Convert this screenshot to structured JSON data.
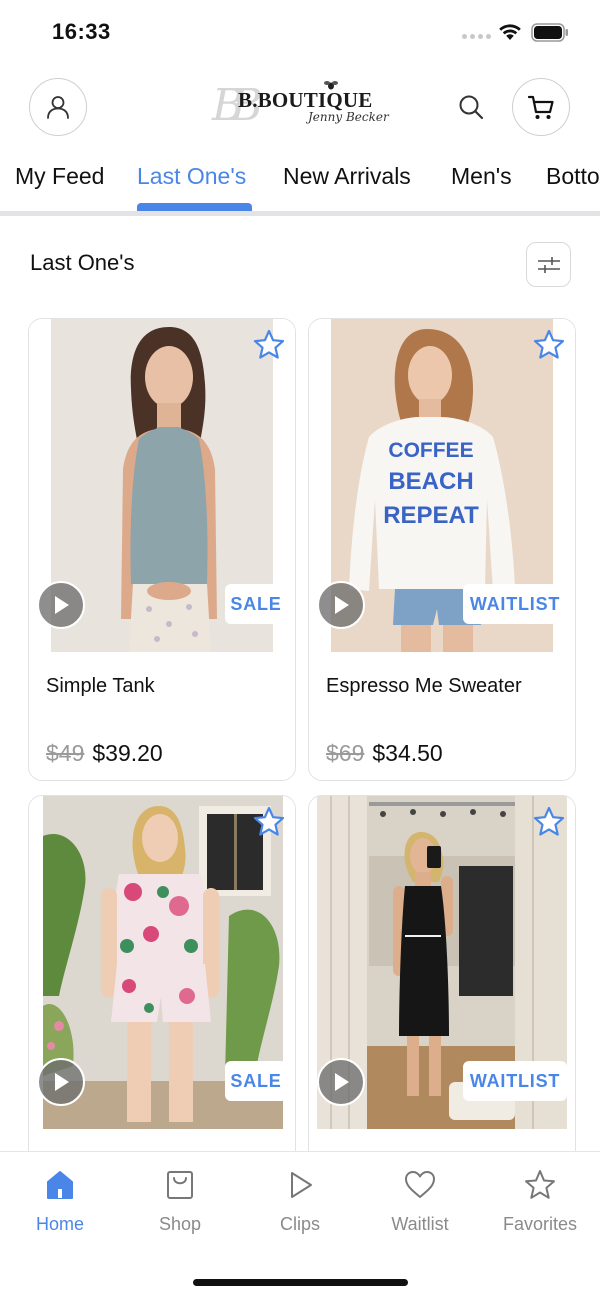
{
  "status_bar": {
    "time": "16:33"
  },
  "header": {
    "logo_text": "B.BOUTIQUE",
    "logo_signature": "Jenny Becker",
    "icons": {
      "profile": "person-icon",
      "search": "search-icon",
      "cart": "cart-icon"
    }
  },
  "tabs": [
    {
      "label": "My Feed",
      "active": false
    },
    {
      "label": "Last One's",
      "active": true
    },
    {
      "label": "New Arrivals",
      "active": false
    },
    {
      "label": "Men's",
      "active": false
    },
    {
      "label": "Botto",
      "active": false
    }
  ],
  "section": {
    "title": "Last One's",
    "filter_icon": "sliders-icon"
  },
  "products": [
    {
      "name": "Simple Tank",
      "old_price": "$49",
      "price": "$39.20",
      "badge": "SALE"
    },
    {
      "name": "Espresso Me Sweater",
      "old_price": "$69",
      "price": "$34.50",
      "badge": "WAITLIST",
      "shirt_text": [
        "COFFEE",
        "BEACH",
        "REPEAT"
      ]
    },
    {
      "name": "",
      "old_price": "",
      "price": "",
      "badge": "SALE"
    },
    {
      "name": "",
      "old_price": "",
      "price": "",
      "badge": "WAITLIST"
    }
  ],
  "bottom_nav": [
    {
      "label": "Home",
      "icon": "home-icon",
      "active": true
    },
    {
      "label": "Shop",
      "icon": "shopping-bag-icon",
      "active": false
    },
    {
      "label": "Clips",
      "icon": "play-icon",
      "active": false
    },
    {
      "label": "Waitlist",
      "icon": "heart-icon",
      "active": false
    },
    {
      "label": "Favorites",
      "icon": "star-icon",
      "active": false
    }
  ],
  "colors": {
    "accent": "#4a86e8",
    "muted": "#8a8a8a",
    "divider": "#e1e3e6"
  }
}
